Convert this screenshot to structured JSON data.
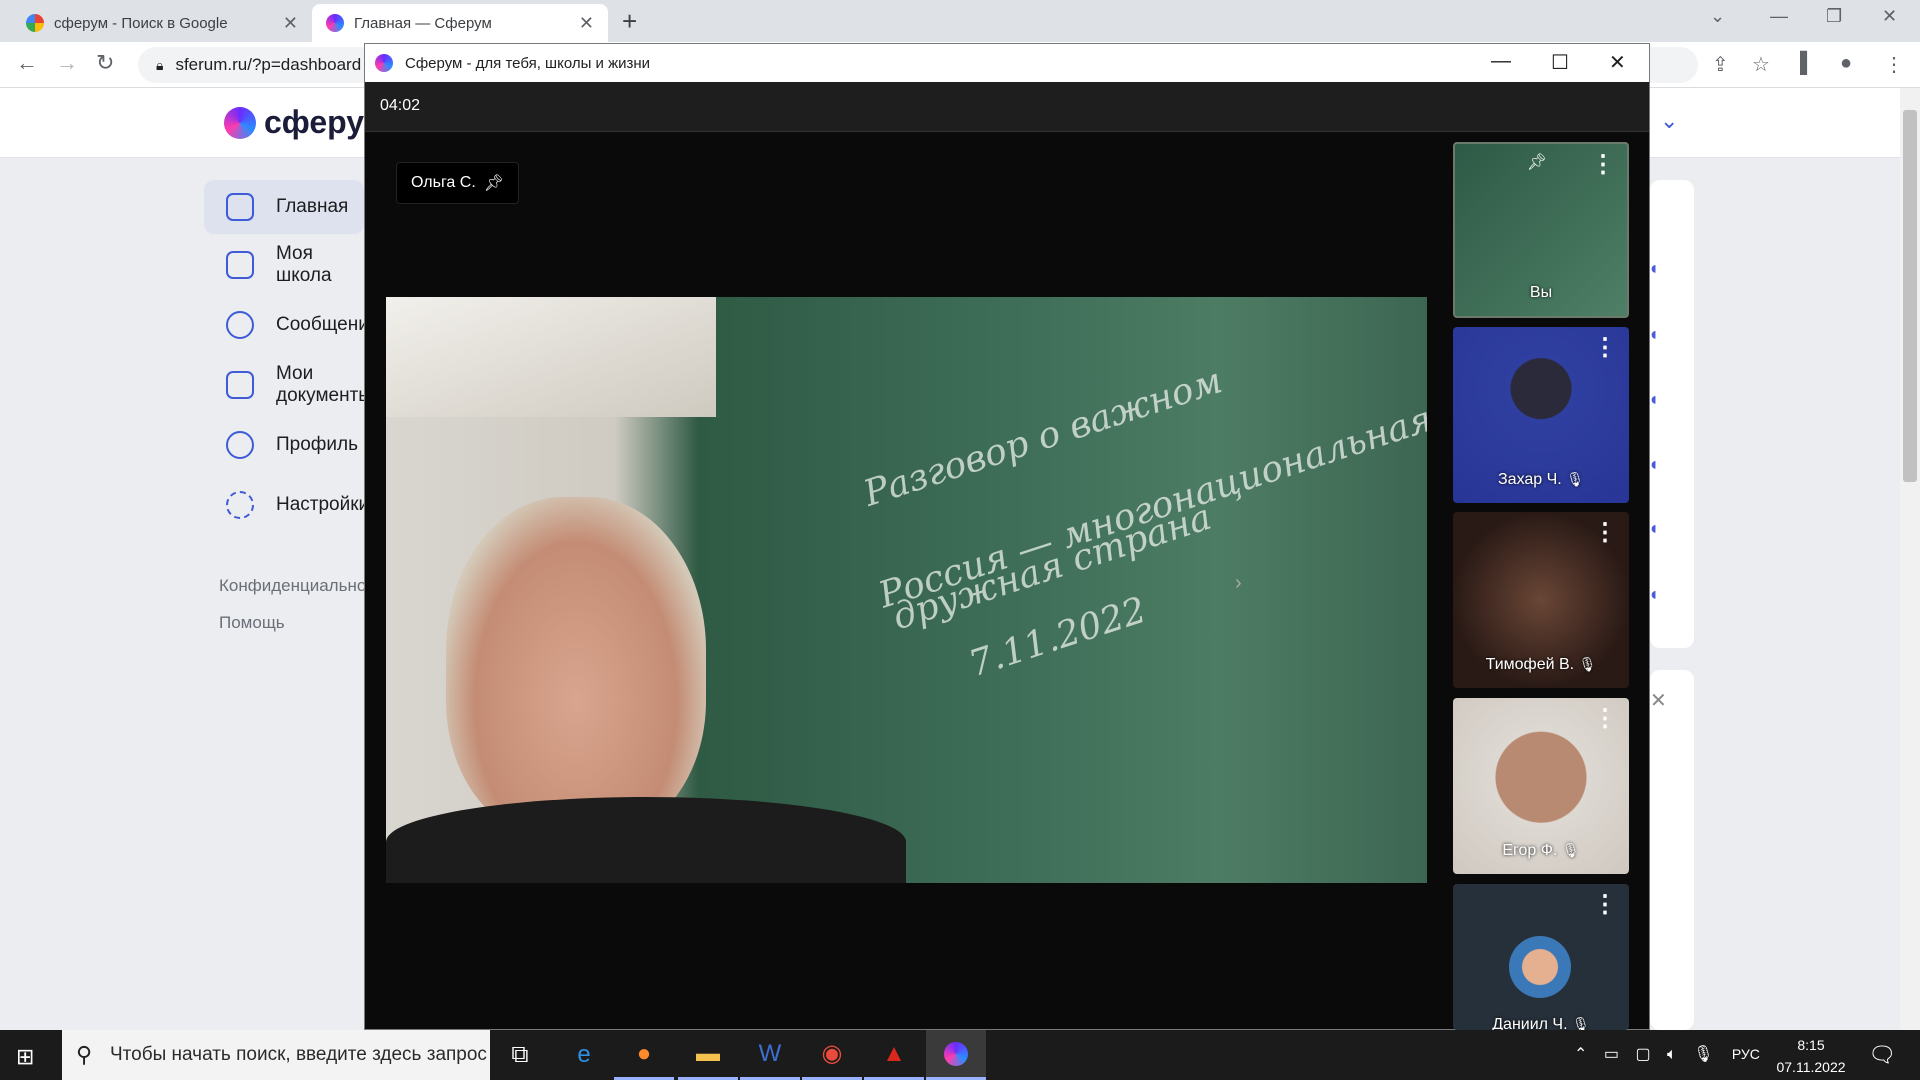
{
  "browser": {
    "tabs": [
      {
        "title": "сферум - Поиск в Google",
        "icon": "google-icon"
      },
      {
        "title": "Главная — Сферум",
        "icon": "sferum-icon"
      }
    ],
    "url": "sferum.ru/?p=dashboard"
  },
  "page": {
    "logo": "сферум",
    "sidebar": [
      {
        "label": "Главная",
        "icon": "grid-icon",
        "active": true
      },
      {
        "label": "Моя школа",
        "icon": "school-icon"
      },
      {
        "label": "Сообщения",
        "icon": "chat-icon"
      },
      {
        "label": "Мои документы",
        "icon": "document-icon"
      },
      {
        "label": "Профиль",
        "icon": "profile-icon"
      },
      {
        "label": "Настройки",
        "icon": "gear-icon"
      }
    ],
    "footer_links": [
      "Конфиденциальность",
      "Помощь"
    ]
  },
  "call": {
    "window_title": "Сферум - для тебя, школы и жизни",
    "timer": "04:02",
    "pinned_name": "Ольга С.",
    "board_text": [
      "Разговор о важном",
      "Россия — многонациональная",
      "дружная страна",
      "7.11.2022"
    ],
    "participants": [
      {
        "name": "Вы",
        "muted": false,
        "pinned": true
      },
      {
        "name": "Захар Ч.",
        "muted": true
      },
      {
        "name": "Тимофей В.",
        "muted": true
      },
      {
        "name": "Егор Ф.",
        "muted": true
      },
      {
        "name": "Даниил Ч.",
        "muted": true
      }
    ]
  },
  "taskbar": {
    "search_placeholder": "Чтобы начать поиск, введите здесь запрос",
    "language": "РУС",
    "time": "8:15",
    "date": "07.11.2022"
  }
}
